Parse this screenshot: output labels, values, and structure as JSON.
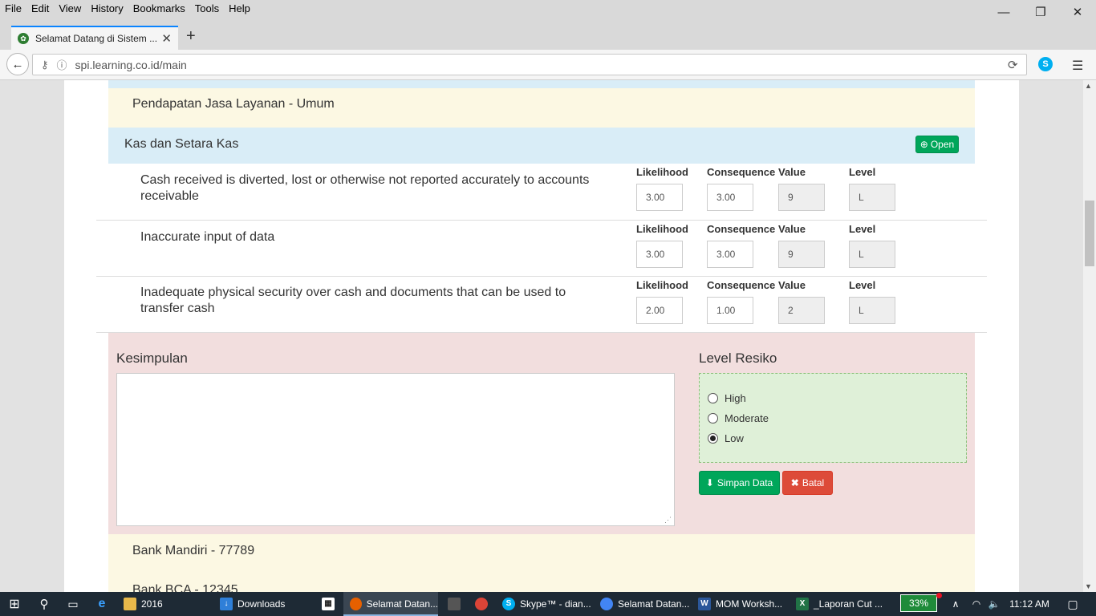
{
  "menu": [
    "File",
    "Edit",
    "View",
    "History",
    "Bookmarks",
    "Tools",
    "Help"
  ],
  "window_controls": {
    "minimize": "—",
    "restore": "❐",
    "close": "✕"
  },
  "tab": {
    "title": "Selamat Datang di Sistem ...",
    "close": "✕",
    "new": "+"
  },
  "nav": {
    "url": "spi.learning.co.id/main",
    "back": "←",
    "info": "ⓘ",
    "reload": "⟳",
    "menu": "☰",
    "skype": "S"
  },
  "content": {
    "subcategory_top": "Pendapatan Jasa Layanan - Umum",
    "group_title": "Kas dan Setara Kas",
    "open_label": "Open",
    "risks": [
      {
        "text": "Cash received is diverted, lost or otherwise not reported accurately to accounts receivable",
        "likelihood": "3.00",
        "consequence": "3.00",
        "value": "9",
        "level": "L"
      },
      {
        "text": "Inaccurate input of data",
        "likelihood": "3.00",
        "consequence": "3.00",
        "value": "9",
        "level": "L"
      },
      {
        "text": "Inadequate physical security over cash and documents that can be used to transfer cash",
        "likelihood": "2.00",
        "consequence": "1.00",
        "value": "2",
        "level": "L"
      }
    ],
    "col_labels": {
      "likelihood": "Likelihood",
      "consequence": "Consequence",
      "value": "Value",
      "level": "Level"
    },
    "kesimpulan_label": "Kesimpulan",
    "kesimpulan_value": "",
    "level_resiko_label": "Level Resiko",
    "level_options": [
      "High",
      "Moderate",
      "Low"
    ],
    "level_selected": "Low",
    "save_label": "Simpan Data",
    "cancel_label": "Batal",
    "subcategory_1": "Bank Mandiri - 77789",
    "subcategory_2": "Bank BCA - 12345"
  },
  "taskbar": {
    "items": [
      "2016",
      "Downloads",
      "Selamat Datan...",
      "Skype™ - dian...",
      "Selamat Datan...",
      "MOM Worksh...",
      "_Laporan Cut ..."
    ],
    "battery": "33%",
    "time": "11:12 AM"
  },
  "colors": {
    "info_blue": "#d9edf7",
    "warning_yellow": "#fcf8e3",
    "danger_pink": "#f2dede",
    "success_green": "#dff0d8",
    "btn_green": "#00a65a",
    "btn_red": "#dd4b39"
  }
}
